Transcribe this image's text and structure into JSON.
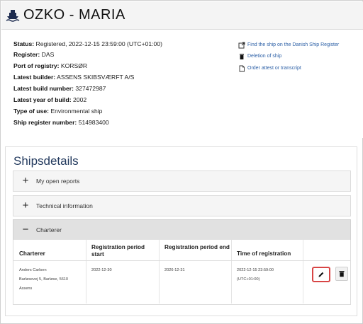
{
  "page": {
    "title": "OZKO - MARIA",
    "title_icon": "ship-icon"
  },
  "info": {
    "status_label": "Status:",
    "status_value": "Registered, 2022-12-15 23:59:00 (UTC+01:00)",
    "register_label": "Register:",
    "register_value": "DAS",
    "port_label": "Port of registry:",
    "port_value": "KORSØR",
    "builder_label": "Latest builder:",
    "builder_value": "ASSENS SKIBSVÆRFT A/S",
    "build_number_label": "Latest build number:",
    "build_number_value": "327472987",
    "build_year_label": "Latest year of build:",
    "build_year_value": "2002",
    "type_label": "Type of use:",
    "type_value": "Environmental ship",
    "ship_number_label": "Ship register number:",
    "ship_number_value": "514983400"
  },
  "actions": {
    "find": "Find the ship on the Danish Ship Register",
    "find_icon": "external-link-icon",
    "delete": "Deletion of ship",
    "delete_icon": "trash-icon",
    "order": "Order attest or transcript",
    "order_icon": "document-icon",
    "link_color": "#2b5fa6"
  },
  "details": {
    "heading": "Shipsdetails",
    "accordions": [
      {
        "label": "My open reports",
        "sign": "+"
      },
      {
        "label": "Technical information",
        "sign": "+"
      },
      {
        "label": "Charterer",
        "sign": "−"
      }
    ],
    "table": {
      "headers": {
        "charterer": "Charterer",
        "reg_start": "Registration period start",
        "reg_end": "Registration period end",
        "time": "Time of registration"
      },
      "rows": [
        {
          "name": "Anders Carlsen",
          "address": "Barløsevej 5, Barløse, 5610",
          "city": "Assens",
          "start": "2022-12-30",
          "end": "2026-12-31",
          "time": "2022-12-15 23:59:00",
          "tz": "(UTC+01:00)"
        }
      ],
      "edit_icon": "pencil-icon",
      "delete_icon": "trash-icon",
      "highlight_color": "#d84545"
    }
  }
}
